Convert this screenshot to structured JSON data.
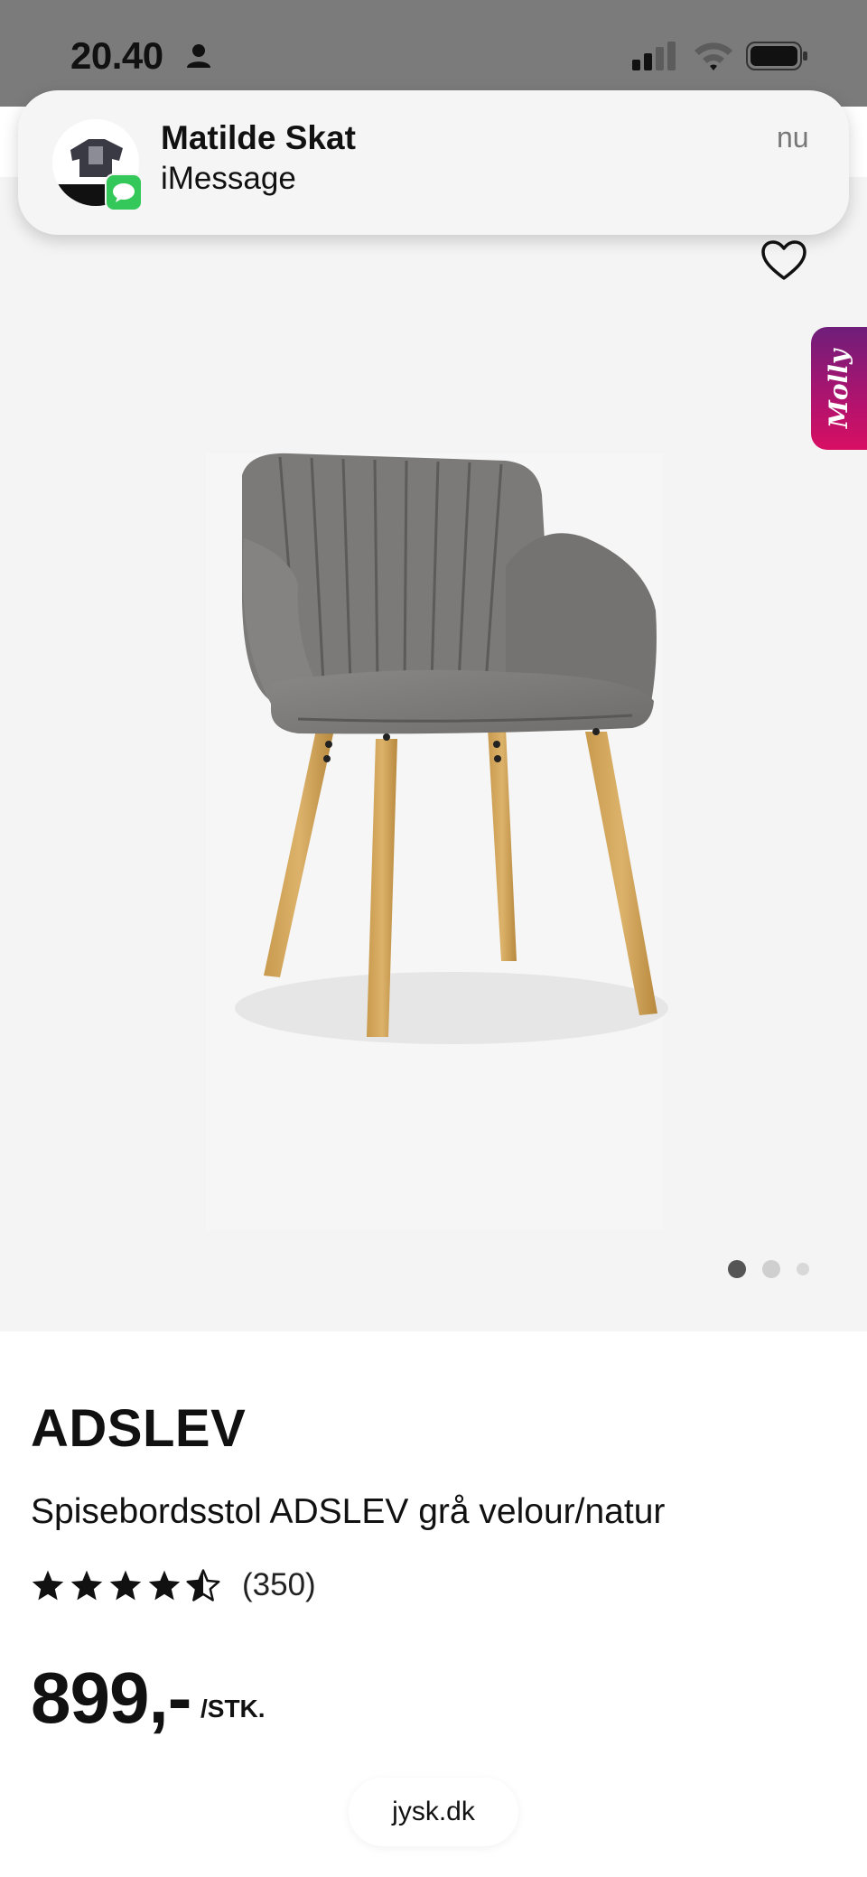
{
  "status_bar": {
    "time": "20.40",
    "icons": [
      "person-icon",
      "signal-icon",
      "wifi-icon",
      "battery-icon"
    ]
  },
  "notification": {
    "sender": "Matilde Skat",
    "app": "iMessage",
    "time": "nu"
  },
  "product": {
    "brand": "ADSLEV",
    "name": "Spisebordsstol ADSLEV grå velour/natur",
    "rating": 4.5,
    "rating_max": 5,
    "reviews": "(350)",
    "price": "899,-",
    "price_unit": "/STK."
  },
  "gallery": {
    "image_count": 3,
    "active_index": 0
  },
  "side_tab": {
    "label": "Molly"
  },
  "browser": {
    "url": "jysk.dk"
  },
  "colors": {
    "status_bar": "#7b7b7b",
    "image_background": "#f4f4f4",
    "molly_gradient_start": "#6e1e7a",
    "molly_gradient_end": "#d80f63",
    "imessage_green": "#34c759"
  }
}
